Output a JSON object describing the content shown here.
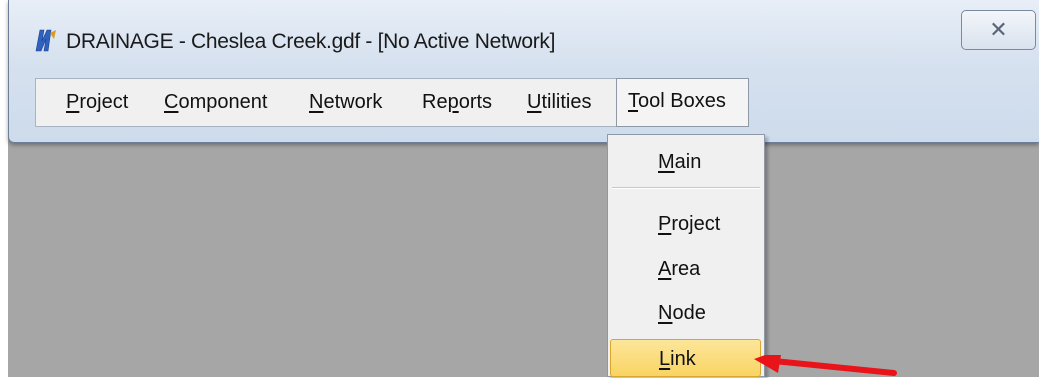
{
  "window": {
    "title": "DRAINAGE - Cheslea Creek.gdf - [No Active Network]",
    "close_glyph": "✕"
  },
  "menubar": {
    "items": [
      {
        "first": "P",
        "rest": "roject"
      },
      {
        "first": "C",
        "rest": "omponent"
      },
      {
        "first": "N",
        "rest": "etwork"
      },
      {
        "pre": "Re",
        "first": "p",
        "rest": "orts"
      },
      {
        "first": "U",
        "rest": "tilities"
      },
      {
        "first": "T",
        "rest": "ool Boxes"
      }
    ],
    "active_index": 5
  },
  "dropdown": {
    "items": [
      {
        "first": "M",
        "rest": "ain"
      },
      {
        "first": "P",
        "rest": "roject"
      },
      {
        "first": "A",
        "rest": "rea"
      },
      {
        "first": "N",
        "rest": "ode"
      },
      {
        "first": "L",
        "rest": "ink"
      }
    ],
    "highlighted_index": 4
  },
  "colors": {
    "highlight": "#f9d463",
    "arrow": "#e8141a",
    "workspace": "#a6a6a6",
    "icon_blue": "#2f62c0"
  },
  "icons": {
    "app": "drainage-app-icon",
    "close": "close-icon",
    "pointer": "red-arrow-icon"
  }
}
